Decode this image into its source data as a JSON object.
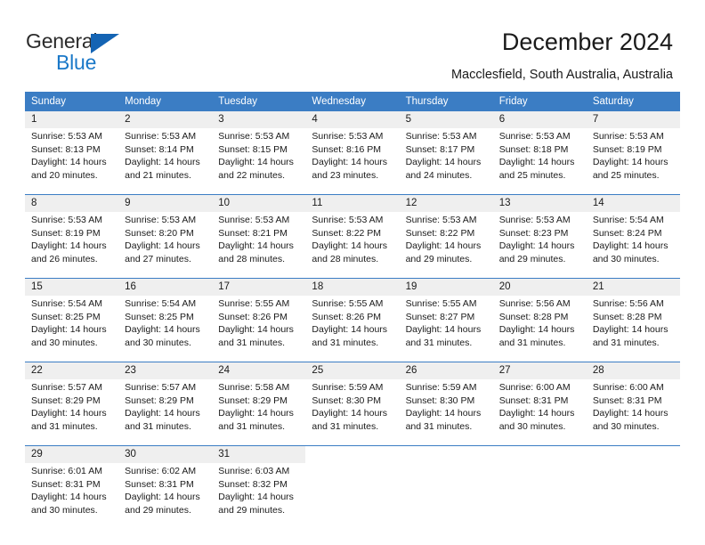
{
  "brand": {
    "name_part1": "General",
    "name_part2": "Blue",
    "triangle_color": "#1464b4",
    "blue_color": "#1a78c8"
  },
  "header": {
    "title": "December 2024",
    "location": "Macclesfield, South Australia, Australia"
  },
  "theme": {
    "header_bg": "#3b7dc4",
    "daynum_bg": "#efefef",
    "text": "#1a1a1a"
  },
  "weekdays": [
    "Sunday",
    "Monday",
    "Tuesday",
    "Wednesday",
    "Thursday",
    "Friday",
    "Saturday"
  ],
  "labels": {
    "sunrise_prefix": "Sunrise:",
    "sunset_prefix": "Sunset:",
    "daylight_prefix": "Daylight:"
  },
  "weeks": [
    {
      "days": [
        {
          "num": "1",
          "sunrise": "Sunrise: 5:53 AM",
          "sunset": "Sunset: 8:13 PM",
          "daylight_line1": "Daylight: 14 hours",
          "daylight_line2": "and 20 minutes."
        },
        {
          "num": "2",
          "sunrise": "Sunrise: 5:53 AM",
          "sunset": "Sunset: 8:14 PM",
          "daylight_line1": "Daylight: 14 hours",
          "daylight_line2": "and 21 minutes."
        },
        {
          "num": "3",
          "sunrise": "Sunrise: 5:53 AM",
          "sunset": "Sunset: 8:15 PM",
          "daylight_line1": "Daylight: 14 hours",
          "daylight_line2": "and 22 minutes."
        },
        {
          "num": "4",
          "sunrise": "Sunrise: 5:53 AM",
          "sunset": "Sunset: 8:16 PM",
          "daylight_line1": "Daylight: 14 hours",
          "daylight_line2": "and 23 minutes."
        },
        {
          "num": "5",
          "sunrise": "Sunrise: 5:53 AM",
          "sunset": "Sunset: 8:17 PM",
          "daylight_line1": "Daylight: 14 hours",
          "daylight_line2": "and 24 minutes."
        },
        {
          "num": "6",
          "sunrise": "Sunrise: 5:53 AM",
          "sunset": "Sunset: 8:18 PM",
          "daylight_line1": "Daylight: 14 hours",
          "daylight_line2": "and 25 minutes."
        },
        {
          "num": "7",
          "sunrise": "Sunrise: 5:53 AM",
          "sunset": "Sunset: 8:19 PM",
          "daylight_line1": "Daylight: 14 hours",
          "daylight_line2": "and 25 minutes."
        }
      ]
    },
    {
      "days": [
        {
          "num": "8",
          "sunrise": "Sunrise: 5:53 AM",
          "sunset": "Sunset: 8:19 PM",
          "daylight_line1": "Daylight: 14 hours",
          "daylight_line2": "and 26 minutes."
        },
        {
          "num": "9",
          "sunrise": "Sunrise: 5:53 AM",
          "sunset": "Sunset: 8:20 PM",
          "daylight_line1": "Daylight: 14 hours",
          "daylight_line2": "and 27 minutes."
        },
        {
          "num": "10",
          "sunrise": "Sunrise: 5:53 AM",
          "sunset": "Sunset: 8:21 PM",
          "daylight_line1": "Daylight: 14 hours",
          "daylight_line2": "and 28 minutes."
        },
        {
          "num": "11",
          "sunrise": "Sunrise: 5:53 AM",
          "sunset": "Sunset: 8:22 PM",
          "daylight_line1": "Daylight: 14 hours",
          "daylight_line2": "and 28 minutes."
        },
        {
          "num": "12",
          "sunrise": "Sunrise: 5:53 AM",
          "sunset": "Sunset: 8:22 PM",
          "daylight_line1": "Daylight: 14 hours",
          "daylight_line2": "and 29 minutes."
        },
        {
          "num": "13",
          "sunrise": "Sunrise: 5:53 AM",
          "sunset": "Sunset: 8:23 PM",
          "daylight_line1": "Daylight: 14 hours",
          "daylight_line2": "and 29 minutes."
        },
        {
          "num": "14",
          "sunrise": "Sunrise: 5:54 AM",
          "sunset": "Sunset: 8:24 PM",
          "daylight_line1": "Daylight: 14 hours",
          "daylight_line2": "and 30 minutes."
        }
      ]
    },
    {
      "days": [
        {
          "num": "15",
          "sunrise": "Sunrise: 5:54 AM",
          "sunset": "Sunset: 8:25 PM",
          "daylight_line1": "Daylight: 14 hours",
          "daylight_line2": "and 30 minutes."
        },
        {
          "num": "16",
          "sunrise": "Sunrise: 5:54 AM",
          "sunset": "Sunset: 8:25 PM",
          "daylight_line1": "Daylight: 14 hours",
          "daylight_line2": "and 30 minutes."
        },
        {
          "num": "17",
          "sunrise": "Sunrise: 5:55 AM",
          "sunset": "Sunset: 8:26 PM",
          "daylight_line1": "Daylight: 14 hours",
          "daylight_line2": "and 31 minutes."
        },
        {
          "num": "18",
          "sunrise": "Sunrise: 5:55 AM",
          "sunset": "Sunset: 8:26 PM",
          "daylight_line1": "Daylight: 14 hours",
          "daylight_line2": "and 31 minutes."
        },
        {
          "num": "19",
          "sunrise": "Sunrise: 5:55 AM",
          "sunset": "Sunset: 8:27 PM",
          "daylight_line1": "Daylight: 14 hours",
          "daylight_line2": "and 31 minutes."
        },
        {
          "num": "20",
          "sunrise": "Sunrise: 5:56 AM",
          "sunset": "Sunset: 8:28 PM",
          "daylight_line1": "Daylight: 14 hours",
          "daylight_line2": "and 31 minutes."
        },
        {
          "num": "21",
          "sunrise": "Sunrise: 5:56 AM",
          "sunset": "Sunset: 8:28 PM",
          "daylight_line1": "Daylight: 14 hours",
          "daylight_line2": "and 31 minutes."
        }
      ]
    },
    {
      "days": [
        {
          "num": "22",
          "sunrise": "Sunrise: 5:57 AM",
          "sunset": "Sunset: 8:29 PM",
          "daylight_line1": "Daylight: 14 hours",
          "daylight_line2": "and 31 minutes."
        },
        {
          "num": "23",
          "sunrise": "Sunrise: 5:57 AM",
          "sunset": "Sunset: 8:29 PM",
          "daylight_line1": "Daylight: 14 hours",
          "daylight_line2": "and 31 minutes."
        },
        {
          "num": "24",
          "sunrise": "Sunrise: 5:58 AM",
          "sunset": "Sunset: 8:29 PM",
          "daylight_line1": "Daylight: 14 hours",
          "daylight_line2": "and 31 minutes."
        },
        {
          "num": "25",
          "sunrise": "Sunrise: 5:59 AM",
          "sunset": "Sunset: 8:30 PM",
          "daylight_line1": "Daylight: 14 hours",
          "daylight_line2": "and 31 minutes."
        },
        {
          "num": "26",
          "sunrise": "Sunrise: 5:59 AM",
          "sunset": "Sunset: 8:30 PM",
          "daylight_line1": "Daylight: 14 hours",
          "daylight_line2": "and 31 minutes."
        },
        {
          "num": "27",
          "sunrise": "Sunrise: 6:00 AM",
          "sunset": "Sunset: 8:31 PM",
          "daylight_line1": "Daylight: 14 hours",
          "daylight_line2": "and 30 minutes."
        },
        {
          "num": "28",
          "sunrise": "Sunrise: 6:00 AM",
          "sunset": "Sunset: 8:31 PM",
          "daylight_line1": "Daylight: 14 hours",
          "daylight_line2": "and 30 minutes."
        }
      ]
    },
    {
      "days": [
        {
          "num": "29",
          "sunrise": "Sunrise: 6:01 AM",
          "sunset": "Sunset: 8:31 PM",
          "daylight_line1": "Daylight: 14 hours",
          "daylight_line2": "and 30 minutes."
        },
        {
          "num": "30",
          "sunrise": "Sunrise: 6:02 AM",
          "sunset": "Sunset: 8:31 PM",
          "daylight_line1": "Daylight: 14 hours",
          "daylight_line2": "and 29 minutes."
        },
        {
          "num": "31",
          "sunrise": "Sunrise: 6:03 AM",
          "sunset": "Sunset: 8:32 PM",
          "daylight_line1": "Daylight: 14 hours",
          "daylight_line2": "and 29 minutes."
        },
        {
          "num": "",
          "sunrise": "",
          "sunset": "",
          "daylight_line1": "",
          "daylight_line2": ""
        },
        {
          "num": "",
          "sunrise": "",
          "sunset": "",
          "daylight_line1": "",
          "daylight_line2": ""
        },
        {
          "num": "",
          "sunrise": "",
          "sunset": "",
          "daylight_line1": "",
          "daylight_line2": ""
        },
        {
          "num": "",
          "sunrise": "",
          "sunset": "",
          "daylight_line1": "",
          "daylight_line2": ""
        }
      ]
    }
  ]
}
